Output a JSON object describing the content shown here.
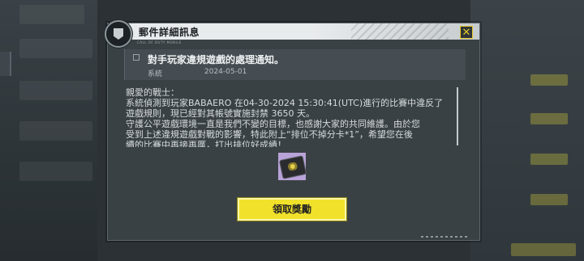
{
  "dialog": {
    "title": "郵件詳細訊息",
    "logo_caption": "CALL OF DUTY MOBILE",
    "close_icon": "close-x-icon"
  },
  "mail": {
    "subject": "對手玩家違規遊戲的處理通知。",
    "sender": "系統",
    "date": "2024-05-01",
    "body": [
      "親愛的戰士：",
      "系統偵測到玩家BABAERO 在04-30-2024 15:30:41(UTC)進行的比賽中違反了",
      "遊戲規則，現已經對其帳號實施封禁 3650 天。",
      "守護公平遊戲環境一直是我們不變的目標，也感謝大家的共同維護。由於您",
      "受到上述違規遊戲對戰的影響，特此附上“排位不掉分卡*1”，希望您在後",
      "續的比賽中再接再厲，打出排位好成績！"
    ]
  },
  "reward": {
    "icon": "rank-protection-card-icon"
  },
  "actions": {
    "claim_label": "領取獎勵"
  },
  "colors": {
    "accent": "#f1e12a",
    "panel": "#3a4145"
  }
}
